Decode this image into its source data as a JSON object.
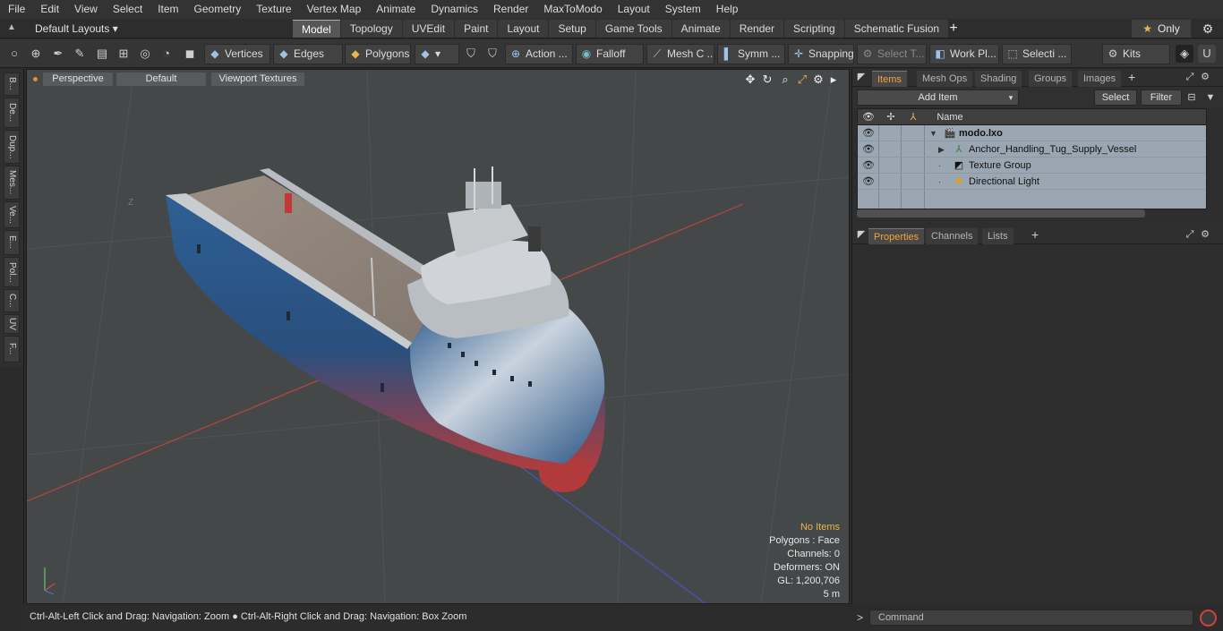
{
  "menubar": {
    "items": [
      "File",
      "Edit",
      "View",
      "Select",
      "Item",
      "Geometry",
      "Texture",
      "Vertex Map",
      "Animate",
      "Dynamics",
      "Render",
      "MaxToModo",
      "Layout",
      "System",
      "Help"
    ]
  },
  "layoutbar": {
    "layout_name": "Default Layouts",
    "tabs": [
      "Model",
      "Topology",
      "UVEdit",
      "Paint",
      "Layout",
      "Setup",
      "Game Tools",
      "Animate",
      "Render",
      "Scripting",
      "Schematic Fusion"
    ],
    "active_tab": "Model",
    "only_label": "Only"
  },
  "toolbar": {
    "vertices": "Vertices",
    "edges": "Edges",
    "polygons": "Polygons",
    "action": "Action ...",
    "falloff": "Falloff",
    "mesh": "Mesh C ...",
    "symm": "Symm ...",
    "snapping": "Snapping",
    "select_t": "Select T...",
    "work_pl": "Work Pl...",
    "selecti": "Selecti ...",
    "kits": "Kits"
  },
  "lefttabs": [
    "B...",
    "De...",
    "Dup...",
    "Mes...",
    "Ve...",
    "E...",
    "Pol...",
    "C...",
    "UV",
    "F..."
  ],
  "viewport": {
    "view_mode": "Perspective",
    "shading": "Default",
    "textures": "Viewport Textures",
    "info": {
      "no_items": "No Items",
      "polygons": "Polygons : Face",
      "channels": "Channels: 0",
      "deformers": "Deformers: ON",
      "gl": "GL: 1,200,706",
      "scale": "5 m"
    },
    "axis_z_label": "Z"
  },
  "statusbar": {
    "text": "Ctrl-Alt-Left Click and Drag: Navigation: Zoom ● Ctrl-Alt-Right Click and Drag: Navigation: Box Zoom"
  },
  "items_panel": {
    "tabs": [
      "Items",
      "Mesh Ops",
      "Shading",
      "Groups",
      "Images"
    ],
    "active_tab": "Items",
    "add_item": "Add Item",
    "select": "Select",
    "filter": "Filter",
    "column_name": "Name",
    "rows": [
      {
        "name": "modo.lxo",
        "bold": true
      },
      {
        "name": "Anchor_Handling_Tug_Supply_Vessel",
        "bold": false
      },
      {
        "name": "Texture Group",
        "bold": false
      },
      {
        "name": "Directional Light",
        "bold": false
      }
    ]
  },
  "properties_panel": {
    "tabs": [
      "Properties",
      "Channels",
      "Lists"
    ],
    "active_tab": "Properties"
  },
  "command": {
    "placeholder": "Command",
    "prompt": ">"
  },
  "colors": {
    "accent_orange": "#f3a33a",
    "hull_blue": "#2d5a8a",
    "hull_red": "#b23a3a",
    "axis_red": "#b5473f",
    "axis_blue": "#4656b8"
  }
}
